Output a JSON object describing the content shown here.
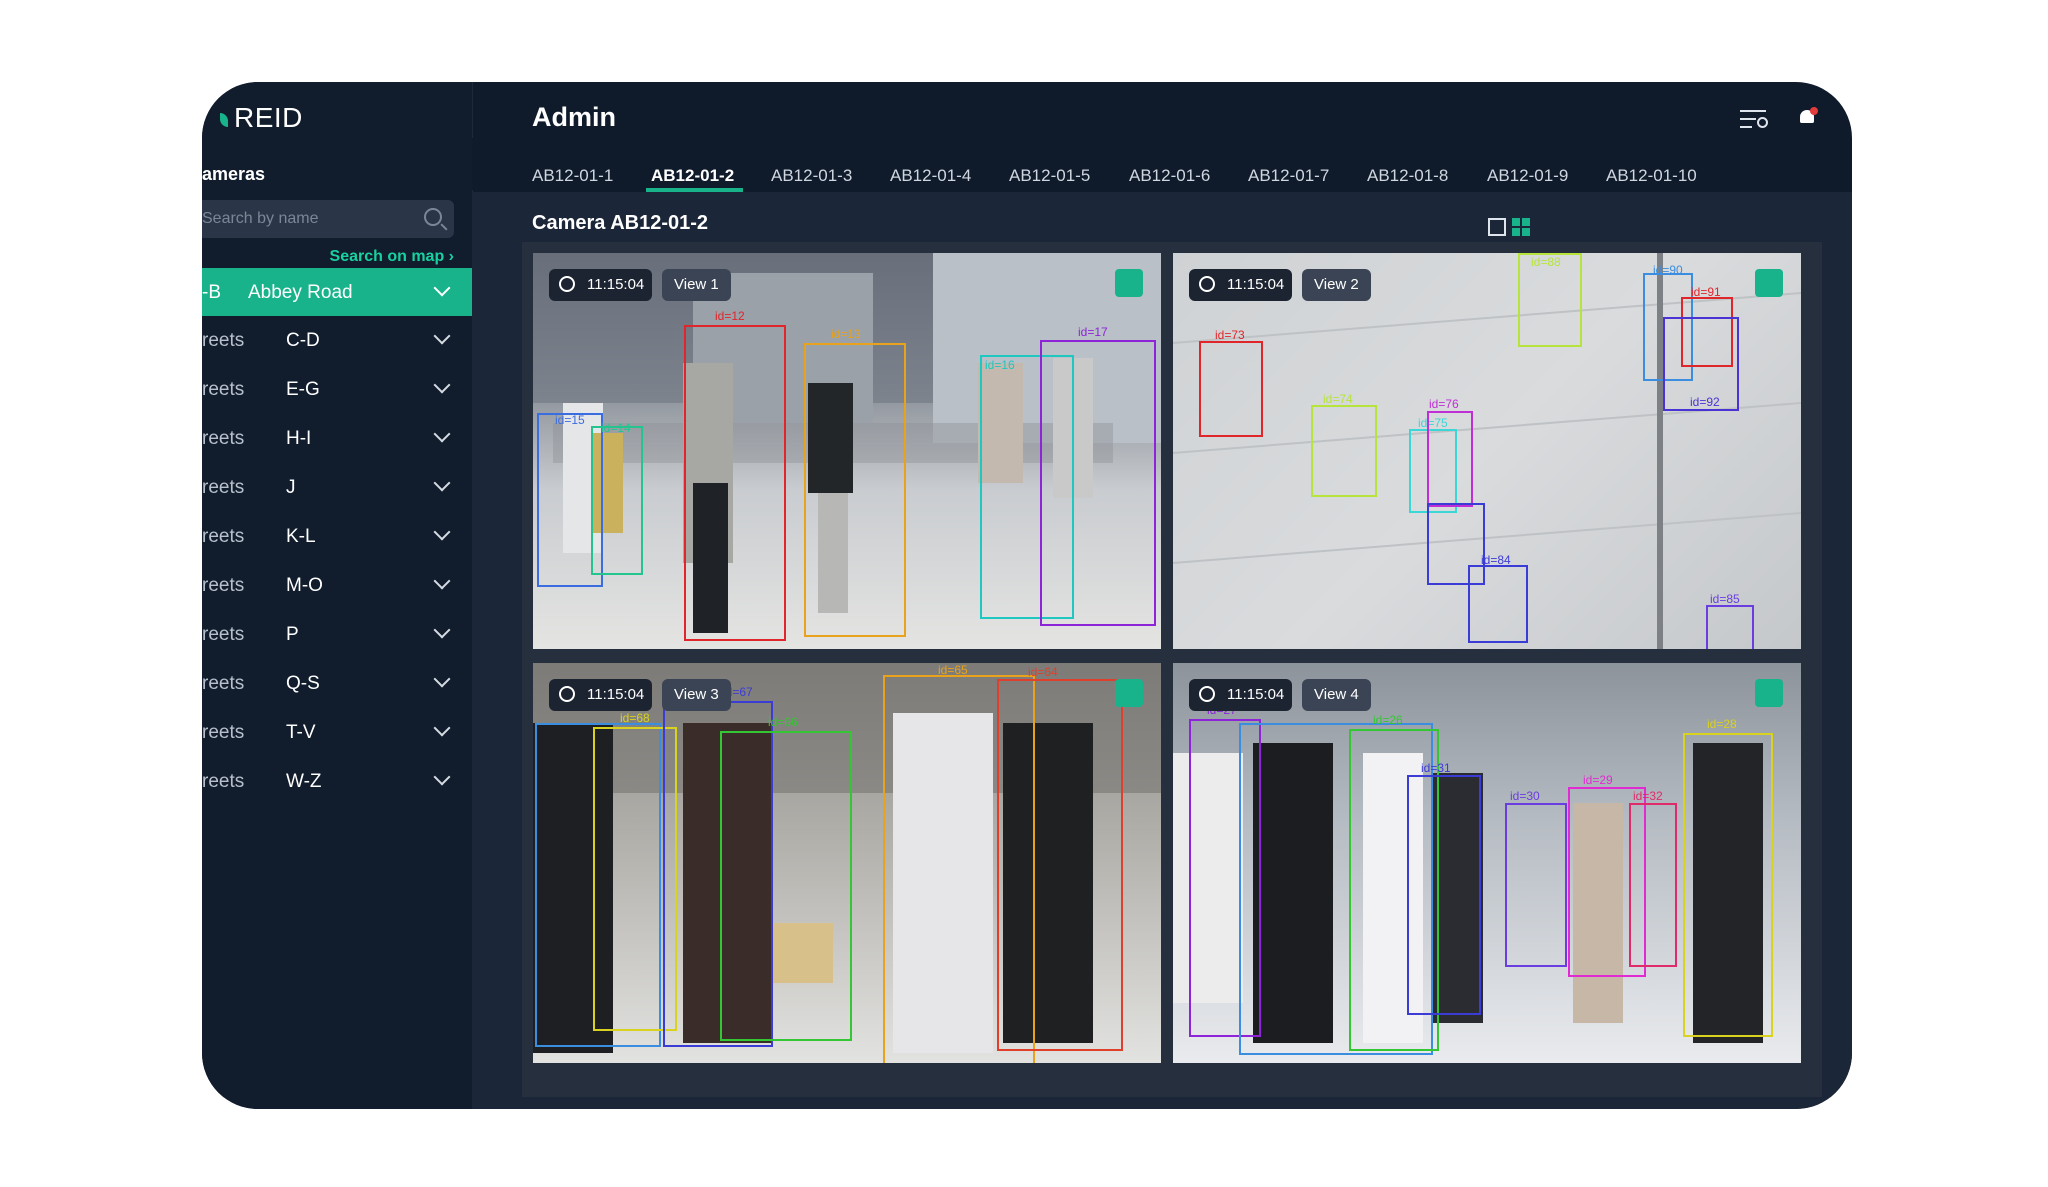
{
  "app": {
    "name": "REID"
  },
  "header": {
    "title": "Admin"
  },
  "sidebar": {
    "title": "ameras",
    "search_placeholder": "Search by name",
    "map_link": "Search on map",
    "regions": [
      {
        "prefix": "-B",
        "name": "Abbey Road",
        "active": true
      },
      {
        "prefix": "reets",
        "name": "C-D"
      },
      {
        "prefix": "reets",
        "name": "E-G"
      },
      {
        "prefix": "reets",
        "name": "H-I"
      },
      {
        "prefix": "reets",
        "name": "J"
      },
      {
        "prefix": "reets",
        "name": "K-L"
      },
      {
        "prefix": "reets",
        "name": "M-O"
      },
      {
        "prefix": "reets",
        "name": "P"
      },
      {
        "prefix": "reets",
        "name": "Q-S"
      },
      {
        "prefix": "reets",
        "name": "T-V"
      },
      {
        "prefix": "reets",
        "name": "W-Z"
      }
    ]
  },
  "tabs": [
    "AB12-01-1",
    "AB12-01-2",
    "AB12-01-3",
    "AB12-01-4",
    "AB12-01-5",
    "AB12-01-6",
    "AB12-01-7",
    "AB12-01-8",
    "AB12-01-9",
    "AB12-01-10"
  ],
  "active_tab": "AB12-01-2",
  "camera": {
    "title": "Camera AB12-01-2"
  },
  "views": [
    {
      "time": "11:15:04",
      "label": "View 1",
      "ids": [
        {
          "id": "id=12",
          "color": "#e0262b"
        },
        {
          "id": "id=17",
          "color": "#8e24d8"
        },
        {
          "id": "id=15",
          "color": "#3b6de0"
        },
        {
          "id": "id=14",
          "color": "#24c48f"
        },
        {
          "id": "id=13",
          "color": "#e8a21b"
        },
        {
          "id": "id=16",
          "color": "#1ec7c0"
        }
      ]
    },
    {
      "time": "11:15:04",
      "label": "View 2",
      "ids": [
        {
          "id": "id=73",
          "color": "#e0262b"
        },
        {
          "id": "id=76",
          "color": "#c02ed6"
        },
        {
          "id": "id=84",
          "color": "#3b3bd6"
        },
        {
          "id": "id=85",
          "color": "#6a3de0"
        },
        {
          "id": "id=91",
          "color": "#e0262b"
        },
        {
          "id": "id=92",
          "color": "#4a33d4"
        },
        {
          "id": "id=90",
          "color": "#3b8de0"
        },
        {
          "id": "id=88",
          "color": "#b7e43b"
        },
        {
          "id": "id=74",
          "color": "#b7e43b"
        },
        {
          "id": "id=75",
          "color": "#3bd6d6"
        }
      ]
    },
    {
      "time": "11:15:04",
      "label": "View 3",
      "ids": [
        {
          "id": "id=68",
          "color": "#d9d21e"
        },
        {
          "id": "id=66",
          "color": "#33c733"
        },
        {
          "id": "id=65",
          "color": "#e8a21b"
        },
        {
          "id": "id=64",
          "color": "#e0402b"
        },
        {
          "id": "id=67",
          "color": "#3b3bd6"
        }
      ]
    },
    {
      "time": "11:15:04",
      "label": "View 4",
      "ids": [
        {
          "id": "id=26",
          "color": "#33c733"
        },
        {
          "id": "id=31",
          "color": "#3b3bd6"
        },
        {
          "id": "id=30",
          "color": "#6a3de0"
        },
        {
          "id": "id=29",
          "color": "#e02bd2"
        },
        {
          "id": "id=32",
          "color": "#e02b6a"
        },
        {
          "id": "id=28",
          "color": "#d9d21e"
        },
        {
          "id": "id=27",
          "color": "#8e24d8"
        }
      ]
    }
  ]
}
